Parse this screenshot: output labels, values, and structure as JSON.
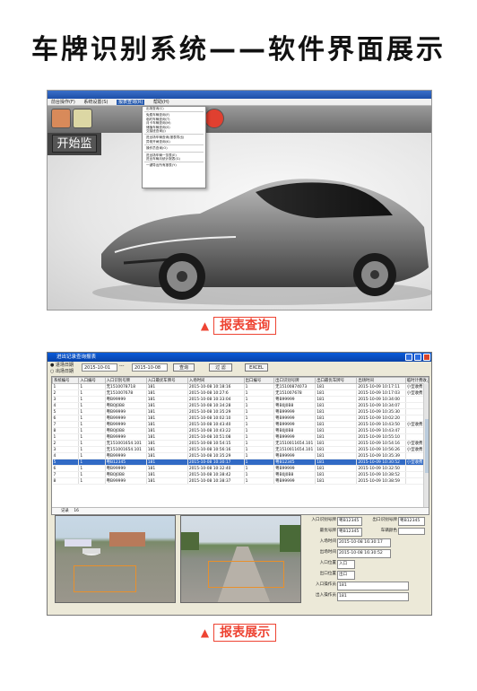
{
  "title": "车牌识别系统——软件界面展示",
  "caption1": "报表查询",
  "caption2": "报表展示",
  "shot1": {
    "menu": [
      "前台操作(F)",
      "系统设置(S)",
      "报表查询(R)",
      "帮助(H)"
    ],
    "start_label": "开始监",
    "dropdown_items": [
      "出场查询(C)",
      "免费车辆查询(F)",
      "临时车辆查询(T)",
      "月卡车辆查询(M)",
      "储值车辆查询(S)",
      "交接班查询(J)",
      "进出场车辆查询(报表导出)",
      "异常开闸查询(K)",
      "操作员查询(O)",
      "进出场车辆一览表(E)",
      "进出车辆月统计报表(G)",
      "一键导出所有报表(Y)"
    ]
  },
  "shot2": {
    "window_title": "进出记录查询报表",
    "radio1": "进场日期",
    "radio2": "出场日期",
    "date_from": "2015-10-01",
    "date_sep": "---",
    "date_to": "2015-10-08",
    "btn_query": "查询",
    "btn_filter": "过 滤",
    "btn_excel": "EXCEL",
    "columns": [
      "系统编号",
      "入口编号",
      "入口识别号牌",
      "入口最优车牌号",
      "入场时间",
      "出口编号",
      "出口识别号牌",
      "出口最优车牌号",
      "出场时间",
      "临时计费收入"
    ],
    "rows": [
      [
        "1",
        "1",
        "无1510078718",
        "181",
        "2015-10-08 10:18:16",
        "1",
        "无15100874073",
        "181",
        "2015-10-09 10:17:11",
        "小型收费"
      ],
      [
        "2",
        "1",
        "无151007678",
        "181",
        "2015-10-08 10:27:6",
        "1",
        "无151007678",
        "181",
        "2015-10-09 10:17:03",
        "小型收费"
      ],
      [
        "3",
        "1",
        "粤B99999",
        "181",
        "2015-10-08 10:33:04",
        "1",
        "粤B99999",
        "181",
        "2015-10-09 10:34:00",
        ""
      ],
      [
        "4",
        "1",
        "粤B0J0B8",
        "181",
        "2015-10-08 10:34:28",
        "1",
        "粤B0J0B8",
        "181",
        "2015-10-09 10:34:07",
        ""
      ],
      [
        "5",
        "1",
        "粤B99999",
        "181",
        "2015-10-08 10:35:29",
        "1",
        "粤B99999",
        "181",
        "2015-10-09 10:35:30",
        ""
      ],
      [
        "6",
        "1",
        "粤B99999",
        "181",
        "2015-10-08 10:02:10",
        "1",
        "粤B99999",
        "181",
        "2015-10-09 10:02:20",
        ""
      ],
      [
        "7",
        "1",
        "粤B99999",
        "181",
        "2015-10-08 10:43:40",
        "1",
        "粤B99999",
        "181",
        "2015-10-09 10:43:50",
        "小型收费"
      ],
      [
        "8",
        "1",
        "粤B0J0B8",
        "181",
        "2015-10-08 10:43:22",
        "1",
        "粤B0J0B8",
        "181",
        "2015-10-09 10:43:47",
        ""
      ],
      [
        "1",
        "1",
        "粤B99999",
        "181",
        "2015-10-08 10:51:08",
        "1",
        "粤B99999",
        "181",
        "2015-10-09 10:55:10",
        ""
      ],
      [
        "2",
        "1",
        "无151001654.101",
        "181",
        "2015-10-08 10:54:15",
        "1",
        "无1510011654.101",
        "181",
        "2015-10-09 10:54:16",
        "小型收费"
      ],
      [
        "3",
        "1",
        "无151001654.101",
        "181",
        "2015-10-08 10:56:16",
        "1",
        "无1510011654.101",
        "181",
        "2015-10-09 10:56:26",
        "小型收费"
      ],
      [
        "4",
        "1",
        "粤B99999",
        "181",
        "2015-10-08 10:35:29",
        "1",
        "粤B99999",
        "181",
        "2015-10-09 10:35:39",
        ""
      ],
      [
        "5",
        "1",
        "粤B12345",
        "181",
        "2015-10-08 10:30:17",
        "1",
        "粤B12345",
        "181",
        "2015-10-09 10:30:52",
        "小型收费"
      ],
      [
        "6",
        "1",
        "粤B99999",
        "181",
        "2015-10-08 10:32:40",
        "1",
        "粤B99999",
        "181",
        "2015-10-09 10:32:50",
        ""
      ],
      [
        "7",
        "1",
        "粤B0J0B8",
        "181",
        "2015-10-08 10:38:42",
        "1",
        "粤B0J0B8",
        "181",
        "2015-10-09 10:38:52",
        ""
      ],
      [
        "8",
        "1",
        "粤B99999",
        "181",
        "2015-10-08 10:38:37",
        "1",
        "粤B99999",
        "181",
        "2015-10-09 10:38:59",
        ""
      ]
    ],
    "selected_row": 12,
    "footer_label": "记录",
    "footer_value": "16",
    "info": {
      "entry_plate_label": "入口识别号牌",
      "entry_plate": "粤B12345",
      "exit_plate_label": "出口识别号牌",
      "exit_plate": "粤B12345",
      "best_plate_label": "最优号牌",
      "best_plate": "粤B12345",
      "plate_color_label": "车辆颜色",
      "plate_color": "",
      "entry_time_label": "入场时间",
      "entry_time": "2015-10-08 16:30:17",
      "exit_time_label": "出场时间",
      "exit_time": "2015-10-08 16:30:52",
      "entry_pos_label": "入口位置",
      "entry_pos": "入口",
      "exit_pos_label": "出口位置",
      "exit_pos": "出口",
      "entry_op_label": "入口操作员",
      "entry_op": "181",
      "exit_op_label": "出入操作员",
      "exit_op": "181"
    }
  }
}
